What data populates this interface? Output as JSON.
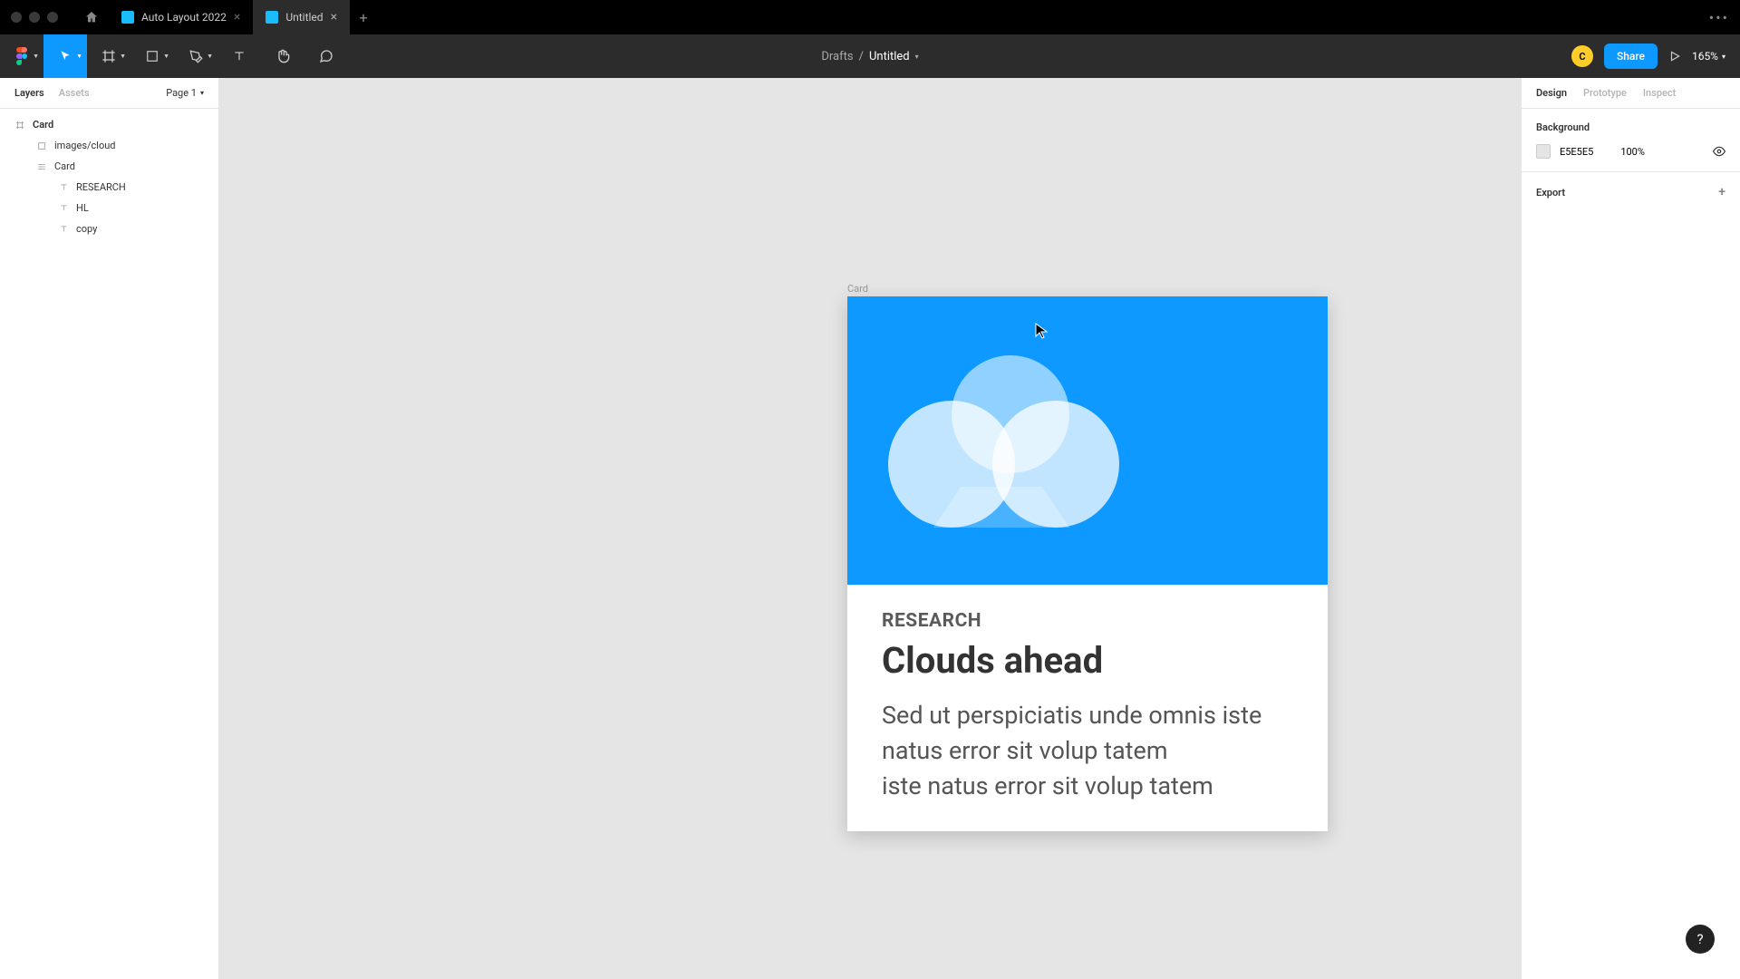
{
  "titlebar": {
    "tabs": [
      {
        "label": "Auto Layout 2022",
        "active": false
      },
      {
        "label": "Untitled",
        "active": true
      }
    ]
  },
  "toolbar": {
    "breadcrumb_parent": "Drafts",
    "breadcrumb_sep": "/",
    "doc_name": "Untitled",
    "avatar_initial": "C",
    "share_label": "Share",
    "zoom_label": "165%"
  },
  "left_panel": {
    "tab_layers": "Layers",
    "tab_assets": "Assets",
    "page_label": "Page 1",
    "layers": {
      "root": "Card",
      "image": "images/cloud",
      "group": "Card",
      "text_research": "RESEARCH",
      "text_hl": "HL",
      "text_copy": "copy"
    }
  },
  "canvas": {
    "frame_label": "Card",
    "card": {
      "category": "RESEARCH",
      "headline": "Clouds ahead",
      "copy": "Sed ut perspiciatis unde omnis iste natus error sit volup tatem\niste natus error sit volup tatem"
    }
  },
  "right_panel": {
    "tab_design": "Design",
    "tab_prototype": "Prototype",
    "tab_inspect": "Inspect",
    "background_title": "Background",
    "background_hex": "E5E5E5",
    "background_opacity": "100%",
    "export_title": "Export"
  },
  "help_label": "?"
}
